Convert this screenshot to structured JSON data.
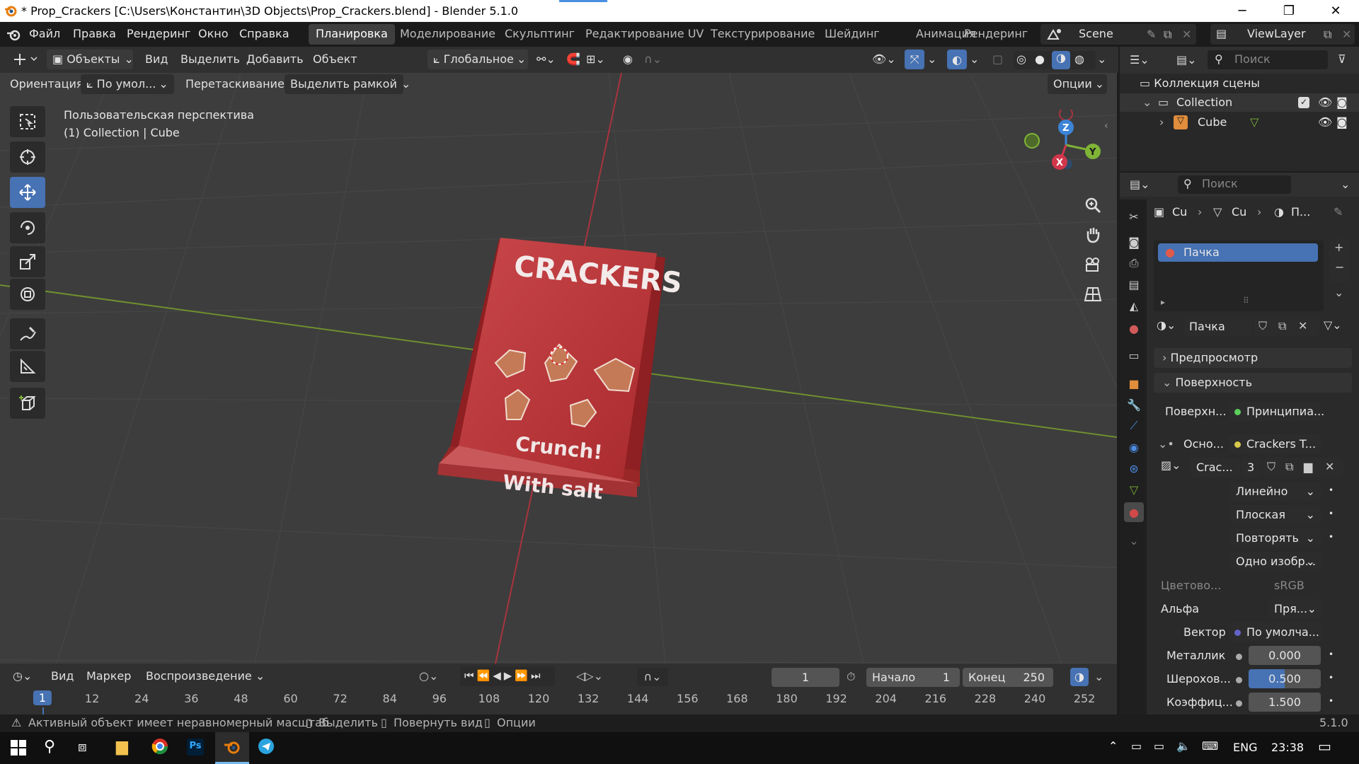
{
  "window": {
    "title": "* Prop_Crackers [C:\\Users\\Константин\\3D Objects\\Prop_Crackers.blend] - Blender 5.1.0",
    "minimize": "─",
    "maximize": "❐",
    "close": "✕"
  },
  "menu": {
    "items": [
      "Файл",
      "Правка",
      "Рендеринг",
      "Окно",
      "Справка"
    ]
  },
  "workspaces": {
    "tabs": [
      "Планировка",
      "Моделирование",
      "Скульптинг",
      "Редактирование UV",
      "Текстурирование",
      "Шейдинг",
      "Анимация",
      "Рендеринг"
    ],
    "active": "Планировка",
    "scene": "Scene",
    "view_layer": "ViewLayer"
  },
  "header3d": {
    "mode": "Объекты",
    "menus": [
      "Вид",
      "Выделить",
      "Добавить",
      "Объект"
    ],
    "transform_orientation": "Глобальное",
    "orientation_label": "Ориентация:",
    "orientation_value": "По умол...",
    "drag_label": "Перетаскивание:",
    "drag_value": "Выделить рамкой",
    "options": "Опции"
  },
  "viewport": {
    "perspective": "Пользовательская перспектива",
    "collection_info": "(1) Collection | Cube",
    "box_text": {
      "title": "CRACKERS",
      "line1": "Crunch!",
      "line2": "With salt"
    },
    "gizmo": {
      "z": "Z",
      "y": "Y",
      "x": "X"
    },
    "colors": {
      "x_axis": "#d0364a",
      "y_axis": "#7fb437",
      "z_axis": "#3b84d6",
      "box": "#c0383a"
    }
  },
  "outliner": {
    "search_placeholder": "Поиск",
    "scene_collection": "Коллекция сцены",
    "collection": "Collection",
    "object": "Cube"
  },
  "properties": {
    "search_placeholder": "Поиск",
    "breadcrumb": [
      "Cu",
      "Cu",
      "П..."
    ],
    "material_slot": "Пачка",
    "material_name": "Пачка",
    "sections": {
      "preview": "Предпросмотр",
      "surface": "Поверхность"
    },
    "surface_label": "Поверхн...",
    "surface_value": "Принципиа...",
    "base_label": "Осно...",
    "base_value": "Crackers T...",
    "image_name": "Crac...",
    "image_users": "3",
    "interpolation": "Линейно",
    "projection": "Плоская",
    "extension": "Повторять",
    "source": "Одно изобр...",
    "colorspace_label": "Цветово...",
    "colorspace_value": "sRGB",
    "alpha_label": "Альфа",
    "alpha_value": "Пря...",
    "vector_label": "Вектор",
    "vector_value": "По умолча...",
    "metallic_label": "Металлик",
    "metallic_value": "0.000",
    "roughness_label": "Шерохов...",
    "roughness_value": "0.500",
    "ior_label": "Коэффиц...",
    "ior_value": "1.500",
    "roughness_fraction": 0.5
  },
  "timeline": {
    "menus": [
      "Вид",
      "Маркер"
    ],
    "playback": "Воспроизведение",
    "current_frame": "1",
    "start_label": "Начало",
    "start_value": "1",
    "end_label": "Конец",
    "end_value": "250",
    "ticks": [
      "1",
      "12",
      "24",
      "36",
      "48",
      "60",
      "72",
      "84",
      "96",
      "108",
      "120",
      "132",
      "144",
      "156",
      "168",
      "180",
      "192",
      "204",
      "216",
      "228",
      "240",
      "252"
    ]
  },
  "status": {
    "warning": "Активный объект имеет неравномерный масштаб",
    "select": "Выделить",
    "rotate": "Повернуть вид",
    "options": "Опции",
    "version": "5.1.0"
  },
  "taskbar": {
    "lang": "ENG",
    "time": "23:38"
  }
}
